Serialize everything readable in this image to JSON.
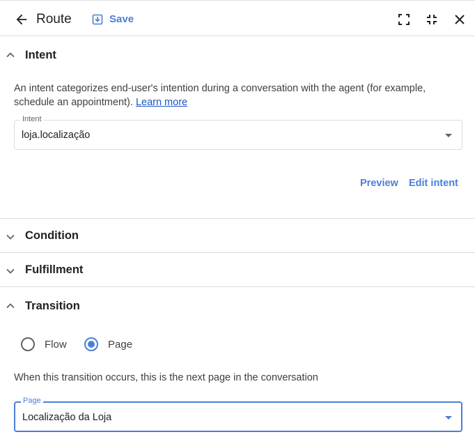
{
  "header": {
    "title": "Route",
    "save_label": "Save"
  },
  "sections": {
    "intent": {
      "label": "Intent",
      "description": "An intent categorizes end-user's intention during a conversation with the agent (for example, schedule an appointment).",
      "learn_more": "Learn more",
      "field_label": "Intent",
      "field_value": "loja.localização",
      "preview_label": "Preview",
      "edit_label": "Edit intent"
    },
    "condition": {
      "label": "Condition"
    },
    "fulfillment": {
      "label": "Fulfillment"
    },
    "transition": {
      "label": "Transition",
      "radio_options": [
        "Flow",
        "Page"
      ],
      "selected_option": "Page",
      "description": "When this transition occurs, this is the next page in the conversation",
      "field_label": "Page",
      "field_value": "Localização da Loja"
    }
  },
  "colors": {
    "accent": "#4a7fd8",
    "link": "#1a55c9",
    "divider": "#dadce0"
  },
  "icons": [
    "arrow-back-icon",
    "save-icon",
    "fullscreen-icon",
    "fullscreen-exit-icon",
    "close-icon",
    "chevron-up-icon",
    "chevron-down-icon"
  ]
}
